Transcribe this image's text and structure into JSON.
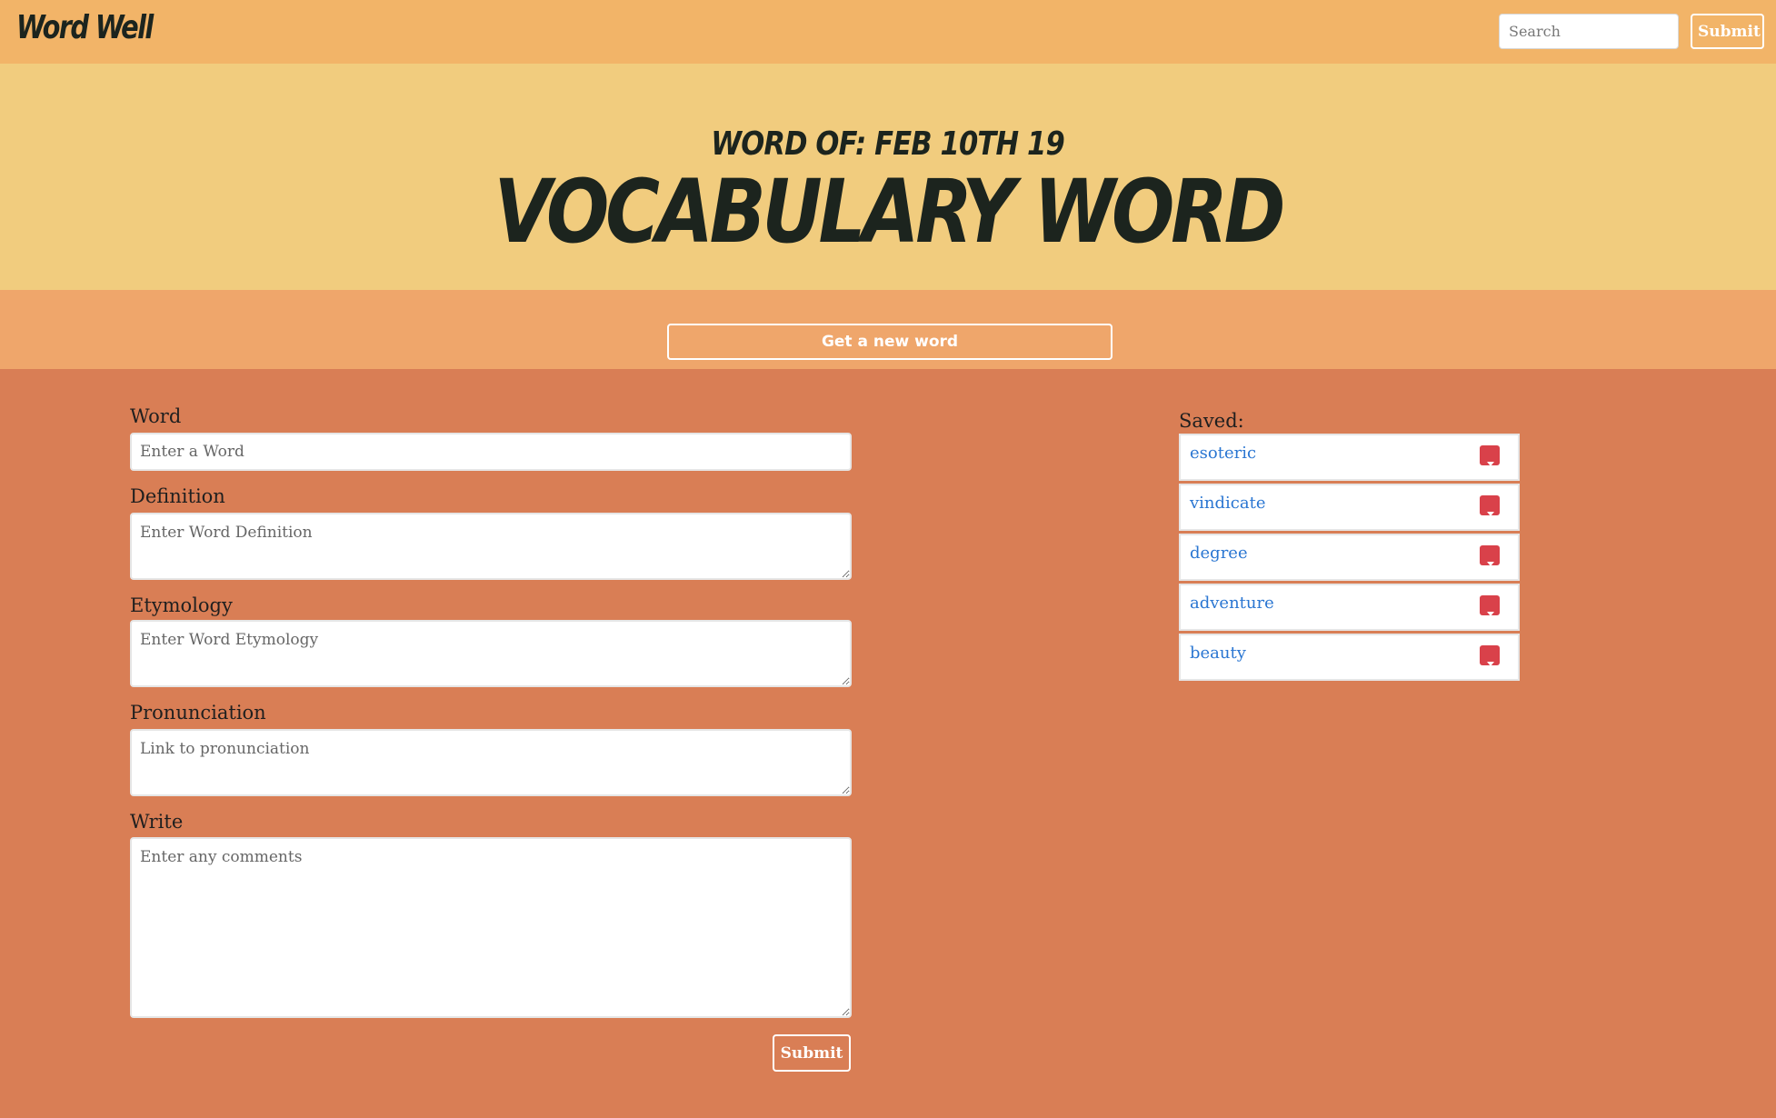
{
  "navbar": {
    "brand": "Word Well",
    "search_placeholder": "Search",
    "submit_label": "Submit"
  },
  "hero": {
    "word_of": "Word of: Feb 10th 19",
    "word": "Vocabulary Word"
  },
  "new_word_button": "Get a new word",
  "form": {
    "word_label": "Word",
    "word_placeholder": "Enter a Word",
    "definition_label": "Definition",
    "definition_placeholder": "Enter Word Definition",
    "etymology_label": "Etymology",
    "etymology_placeholder": "Enter Word Etymology",
    "pronunciation_label": "Pronunciation",
    "pronunciation_placeholder": "Link to pronunciation",
    "write_label": "Write",
    "write_placeholder": "Enter any comments",
    "submit_label": "Submit"
  },
  "saved": {
    "label": "Saved:",
    "items": [
      {
        "word": "esoteric"
      },
      {
        "word": "vindicate"
      },
      {
        "word": "degree"
      },
      {
        "word": "adventure"
      },
      {
        "word": "beauty"
      }
    ],
    "delete_icon": "delete-dropdown-icon",
    "delete_color": "#d9414a",
    "link_color": "#2a76d2"
  },
  "colors": {
    "navbar": "#f2b468",
    "hero": "#f1cc7e",
    "new_word_bar": "#efa66b",
    "page": "#d97e55"
  }
}
